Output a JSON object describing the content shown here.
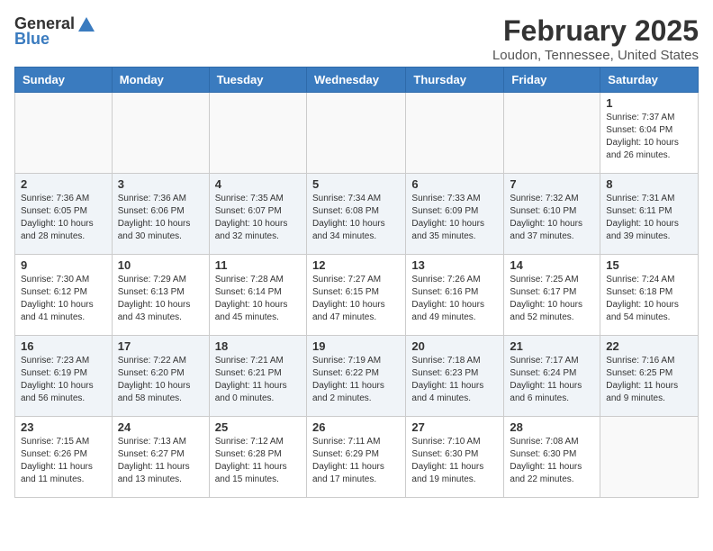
{
  "logo": {
    "general": "General",
    "blue": "Blue"
  },
  "title": "February 2025",
  "subtitle": "Loudon, Tennessee, United States",
  "days_of_week": [
    "Sunday",
    "Monday",
    "Tuesday",
    "Wednesday",
    "Thursday",
    "Friday",
    "Saturday"
  ],
  "weeks": [
    [
      {
        "day": "",
        "info": ""
      },
      {
        "day": "",
        "info": ""
      },
      {
        "day": "",
        "info": ""
      },
      {
        "day": "",
        "info": ""
      },
      {
        "day": "",
        "info": ""
      },
      {
        "day": "",
        "info": ""
      },
      {
        "day": "1",
        "info": "Sunrise: 7:37 AM\nSunset: 6:04 PM\nDaylight: 10 hours and 26 minutes."
      }
    ],
    [
      {
        "day": "2",
        "info": "Sunrise: 7:36 AM\nSunset: 6:05 PM\nDaylight: 10 hours and 28 minutes."
      },
      {
        "day": "3",
        "info": "Sunrise: 7:36 AM\nSunset: 6:06 PM\nDaylight: 10 hours and 30 minutes."
      },
      {
        "day": "4",
        "info": "Sunrise: 7:35 AM\nSunset: 6:07 PM\nDaylight: 10 hours and 32 minutes."
      },
      {
        "day": "5",
        "info": "Sunrise: 7:34 AM\nSunset: 6:08 PM\nDaylight: 10 hours and 34 minutes."
      },
      {
        "day": "6",
        "info": "Sunrise: 7:33 AM\nSunset: 6:09 PM\nDaylight: 10 hours and 35 minutes."
      },
      {
        "day": "7",
        "info": "Sunrise: 7:32 AM\nSunset: 6:10 PM\nDaylight: 10 hours and 37 minutes."
      },
      {
        "day": "8",
        "info": "Sunrise: 7:31 AM\nSunset: 6:11 PM\nDaylight: 10 hours and 39 minutes."
      }
    ],
    [
      {
        "day": "9",
        "info": "Sunrise: 7:30 AM\nSunset: 6:12 PM\nDaylight: 10 hours and 41 minutes."
      },
      {
        "day": "10",
        "info": "Sunrise: 7:29 AM\nSunset: 6:13 PM\nDaylight: 10 hours and 43 minutes."
      },
      {
        "day": "11",
        "info": "Sunrise: 7:28 AM\nSunset: 6:14 PM\nDaylight: 10 hours and 45 minutes."
      },
      {
        "day": "12",
        "info": "Sunrise: 7:27 AM\nSunset: 6:15 PM\nDaylight: 10 hours and 47 minutes."
      },
      {
        "day": "13",
        "info": "Sunrise: 7:26 AM\nSunset: 6:16 PM\nDaylight: 10 hours and 49 minutes."
      },
      {
        "day": "14",
        "info": "Sunrise: 7:25 AM\nSunset: 6:17 PM\nDaylight: 10 hours and 52 minutes."
      },
      {
        "day": "15",
        "info": "Sunrise: 7:24 AM\nSunset: 6:18 PM\nDaylight: 10 hours and 54 minutes."
      }
    ],
    [
      {
        "day": "16",
        "info": "Sunrise: 7:23 AM\nSunset: 6:19 PM\nDaylight: 10 hours and 56 minutes."
      },
      {
        "day": "17",
        "info": "Sunrise: 7:22 AM\nSunset: 6:20 PM\nDaylight: 10 hours and 58 minutes."
      },
      {
        "day": "18",
        "info": "Sunrise: 7:21 AM\nSunset: 6:21 PM\nDaylight: 11 hours and 0 minutes."
      },
      {
        "day": "19",
        "info": "Sunrise: 7:19 AM\nSunset: 6:22 PM\nDaylight: 11 hours and 2 minutes."
      },
      {
        "day": "20",
        "info": "Sunrise: 7:18 AM\nSunset: 6:23 PM\nDaylight: 11 hours and 4 minutes."
      },
      {
        "day": "21",
        "info": "Sunrise: 7:17 AM\nSunset: 6:24 PM\nDaylight: 11 hours and 6 minutes."
      },
      {
        "day": "22",
        "info": "Sunrise: 7:16 AM\nSunset: 6:25 PM\nDaylight: 11 hours and 9 minutes."
      }
    ],
    [
      {
        "day": "23",
        "info": "Sunrise: 7:15 AM\nSunset: 6:26 PM\nDaylight: 11 hours and 11 minutes."
      },
      {
        "day": "24",
        "info": "Sunrise: 7:13 AM\nSunset: 6:27 PM\nDaylight: 11 hours and 13 minutes."
      },
      {
        "day": "25",
        "info": "Sunrise: 7:12 AM\nSunset: 6:28 PM\nDaylight: 11 hours and 15 minutes."
      },
      {
        "day": "26",
        "info": "Sunrise: 7:11 AM\nSunset: 6:29 PM\nDaylight: 11 hours and 17 minutes."
      },
      {
        "day": "27",
        "info": "Sunrise: 7:10 AM\nSunset: 6:30 PM\nDaylight: 11 hours and 19 minutes."
      },
      {
        "day": "28",
        "info": "Sunrise: 7:08 AM\nSunset: 6:30 PM\nDaylight: 11 hours and 22 minutes."
      },
      {
        "day": "",
        "info": ""
      }
    ]
  ]
}
